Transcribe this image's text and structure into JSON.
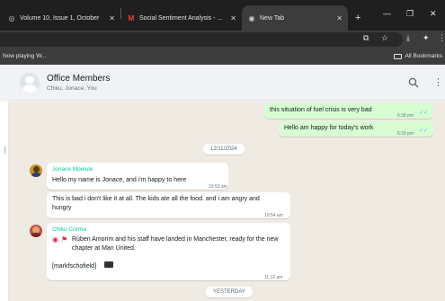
{
  "browser": {
    "tabs": [
      {
        "title": "Volume 10, Issue 1, October"
      },
      {
        "title": "Social Sentiment Analysis - ..."
      },
      {
        "title": "New Tab"
      }
    ],
    "new_tab_symbol": "+",
    "bookmarks": {
      "left_item": "Now playing W...",
      "right_item": "All Bookmarks"
    }
  },
  "chat": {
    "title": "Office Members",
    "members": "Chiku, Jonace, You"
  },
  "messages": {
    "out1": {
      "text": "this situation of fuel  crisis is very bad",
      "time": "6:38 pm"
    },
    "out2": {
      "text": "Hello am happy for today's work",
      "time": "6:39 pm"
    },
    "date1": "12/11/2024",
    "jonace": {
      "sender": "Jonace Mpelule",
      "msg1": {
        "text": "Hello my name is Jonace, and i'm happy to here",
        "time": "10:53 am"
      },
      "msg2": {
        "text": "This is bad i don't like it at all. The kids ate all the food. and i am angry and hungry",
        "time": "10:54 am"
      }
    },
    "chiku": {
      "sender": "Chiku Corma",
      "text": "Rúben Amorim and his staff have landed in Manchester, ready for the new chapter at Man United.",
      "credit": "[markfschofield]",
      "time": "11:12 am"
    },
    "date2": "YESTERDAY"
  },
  "colors": {
    "outgoing_bubble": "#d9fdd3",
    "incoming_bubble": "#ffffff",
    "sender_name": "#06cf9c",
    "chat_background": "#efeae2",
    "read_ticks": "#53bdeb"
  },
  "icons": {
    "search": "search-icon",
    "menu": "kebab-menu-icon"
  }
}
